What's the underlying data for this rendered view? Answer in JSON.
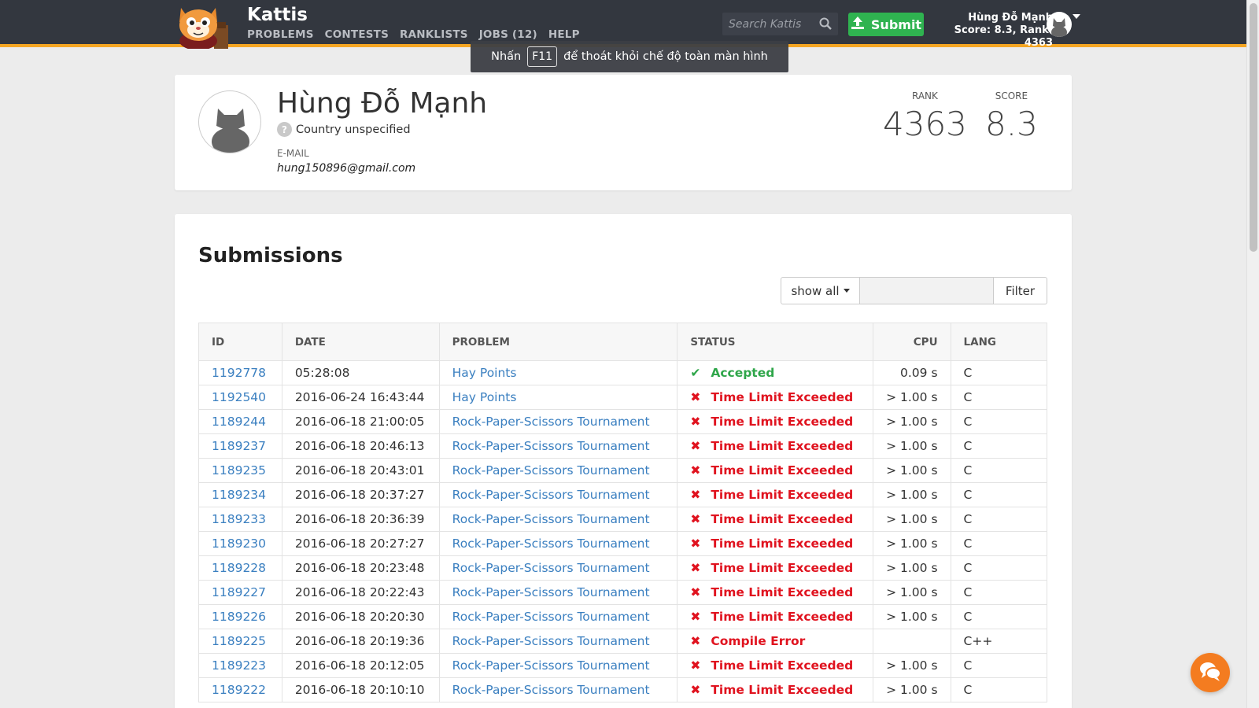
{
  "header": {
    "brand": "Kattis",
    "nav": [
      "PROBLEMS",
      "CONTESTS",
      "RANKLISTS",
      "JOBS (12)",
      "HELP"
    ],
    "search_placeholder": "Search Kattis",
    "submit_label": "Submit",
    "user_name": "Hùng Đỗ Mạnh",
    "user_stats": "Score: 8.3, Rank: 4363"
  },
  "fullscreen_hint": {
    "before": "Nhấn",
    "key": "F11",
    "after": "để thoát khỏi chế độ toàn màn hình"
  },
  "profile": {
    "name": "Hùng Đỗ Mạnh",
    "country": "Country unspecified",
    "email_label": "E-MAIL",
    "email": "hung150896@gmail.com",
    "rank_label": "RANK",
    "rank": "4363",
    "score_label": "SCORE",
    "score": "8.3"
  },
  "submissions": {
    "title": "Submissions",
    "filter_select": "show all",
    "filter_button": "Filter",
    "columns": [
      "ID",
      "DATE",
      "PROBLEM",
      "STATUS",
      "CPU",
      "LANG"
    ],
    "rows": [
      {
        "id": "1192778",
        "date": "05:28:08",
        "problem": "Hay Points",
        "status": "Accepted",
        "cpu": "0.09 s",
        "lang": "C"
      },
      {
        "id": "1192540",
        "date": "2016-06-24 16:43:44",
        "problem": "Hay Points",
        "status": "Time Limit Exceeded",
        "cpu": "> 1.00 s",
        "lang": "C"
      },
      {
        "id": "1189244",
        "date": "2016-06-18 21:00:05",
        "problem": "Rock-Paper-Scissors Tournament",
        "status": "Time Limit Exceeded",
        "cpu": "> 1.00 s",
        "lang": "C"
      },
      {
        "id": "1189237",
        "date": "2016-06-18 20:46:13",
        "problem": "Rock-Paper-Scissors Tournament",
        "status": "Time Limit Exceeded",
        "cpu": "> 1.00 s",
        "lang": "C"
      },
      {
        "id": "1189235",
        "date": "2016-06-18 20:43:01",
        "problem": "Rock-Paper-Scissors Tournament",
        "status": "Time Limit Exceeded",
        "cpu": "> 1.00 s",
        "lang": "C"
      },
      {
        "id": "1189234",
        "date": "2016-06-18 20:37:27",
        "problem": "Rock-Paper-Scissors Tournament",
        "status": "Time Limit Exceeded",
        "cpu": "> 1.00 s",
        "lang": "C"
      },
      {
        "id": "1189233",
        "date": "2016-06-18 20:36:39",
        "problem": "Rock-Paper-Scissors Tournament",
        "status": "Time Limit Exceeded",
        "cpu": "> 1.00 s",
        "lang": "C"
      },
      {
        "id": "1189230",
        "date": "2016-06-18 20:27:27",
        "problem": "Rock-Paper-Scissors Tournament",
        "status": "Time Limit Exceeded",
        "cpu": "> 1.00 s",
        "lang": "C"
      },
      {
        "id": "1189228",
        "date": "2016-06-18 20:23:48",
        "problem": "Rock-Paper-Scissors Tournament",
        "status": "Time Limit Exceeded",
        "cpu": "> 1.00 s",
        "lang": "C"
      },
      {
        "id": "1189227",
        "date": "2016-06-18 20:22:43",
        "problem": "Rock-Paper-Scissors Tournament",
        "status": "Time Limit Exceeded",
        "cpu": "> 1.00 s",
        "lang": "C"
      },
      {
        "id": "1189226",
        "date": "2016-06-18 20:20:30",
        "problem": "Rock-Paper-Scissors Tournament",
        "status": "Time Limit Exceeded",
        "cpu": "> 1.00 s",
        "lang": "C"
      },
      {
        "id": "1189225",
        "date": "2016-06-18 20:19:36",
        "problem": "Rock-Paper-Scissors Tournament",
        "status": "Compile Error",
        "cpu": "",
        "lang": "C++"
      },
      {
        "id": "1189223",
        "date": "2016-06-18 20:12:05",
        "problem": "Rock-Paper-Scissors Tournament",
        "status": "Time Limit Exceeded",
        "cpu": "> 1.00 s",
        "lang": "C"
      },
      {
        "id": "1189222",
        "date": "2016-06-18 20:10:10",
        "problem": "Rock-Paper-Scissors Tournament",
        "status": "Time Limit Exceeded",
        "cpu": "> 1.00 s",
        "lang": "C"
      }
    ]
  },
  "colors": {
    "topbar": "#33373f",
    "accent": "#f5a623",
    "submit_green": "#2fb350",
    "accepted": "#2fa64a",
    "rejected": "#e0131f",
    "link": "#3a7fc0",
    "chat": "#f47c20"
  },
  "icons": {
    "search": "search-icon",
    "upload": "upload-icon",
    "accepted": "check-icon",
    "rejected": "cross-icon",
    "country": "question-icon",
    "chat": "chat-icon"
  }
}
